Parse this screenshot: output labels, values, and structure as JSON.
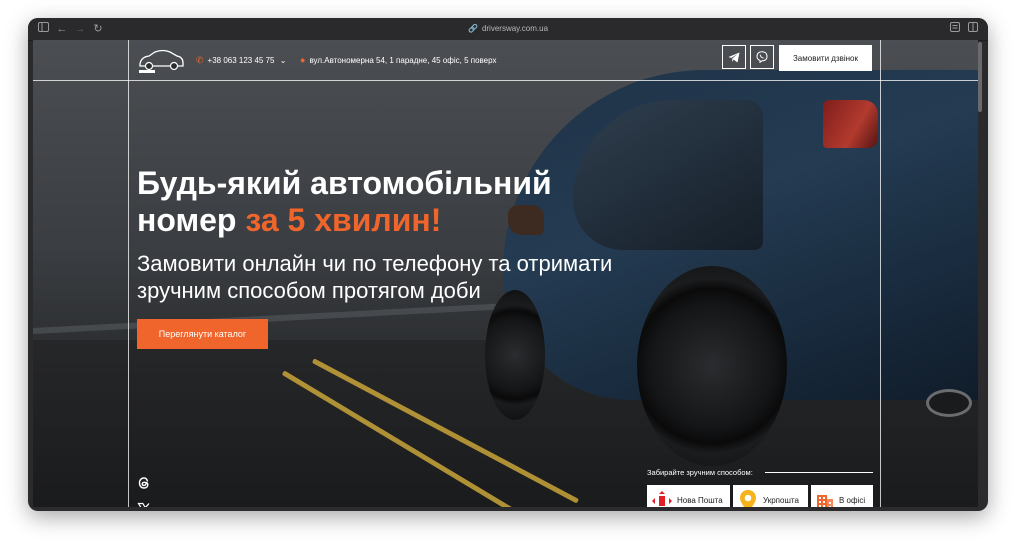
{
  "browser": {
    "url": "driversway.com.ua"
  },
  "header": {
    "phone": "+38 063 123 45 75",
    "address": "вул.Автономерна 54, 1 парадне, 45 офіс, 5 поверх",
    "callback_label": "Замовити дзвінок"
  },
  "hero": {
    "title_line1": "Будь-який автомобільний",
    "title_line2_prefix": "номер ",
    "title_line2_accent": "за 5 хвилин!",
    "subtitle": "Замовити онлайн чи по телефону та отримати зручним способом протягом доби",
    "cta_label": "Переглянути каталог"
  },
  "delivery": {
    "label": "Забирайте зручним способом:",
    "options": [
      {
        "label": "Нова Пошта",
        "icon": "nova-poshta-icon"
      },
      {
        "label": "Укрпошта",
        "icon": "ukrposhta-icon"
      },
      {
        "label": "В офісі",
        "icon": "office-building-icon"
      }
    ]
  },
  "colors": {
    "accent": "#f0652b",
    "nova_poshta": "#e31e24",
    "ukrposhta": "#f6b21b"
  }
}
